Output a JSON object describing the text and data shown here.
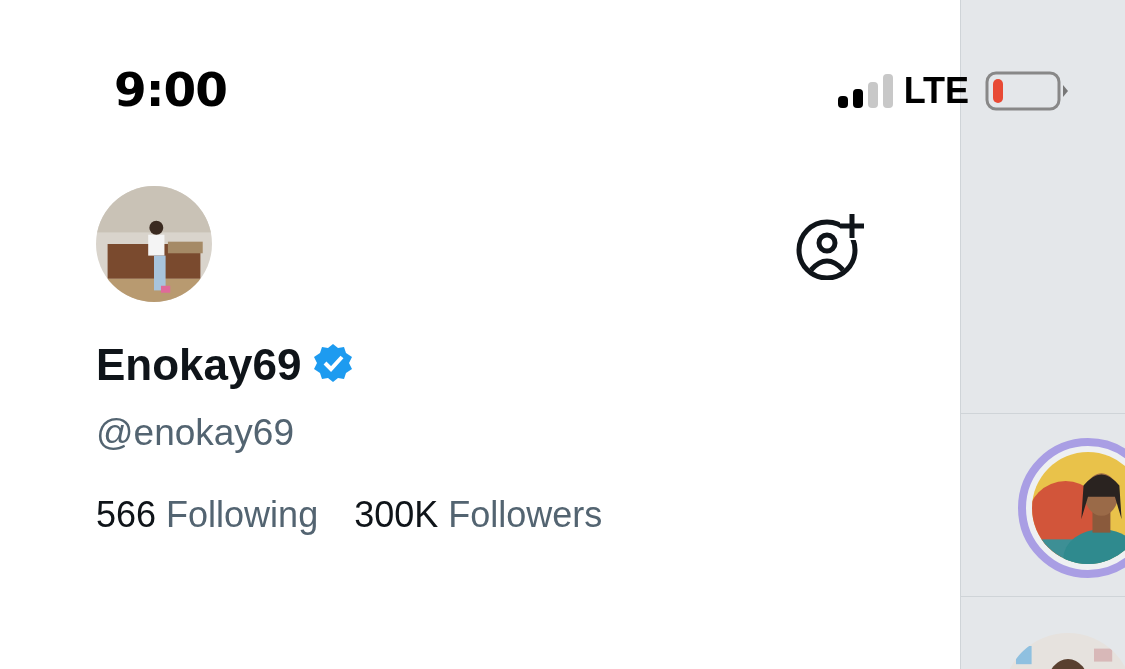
{
  "status_bar": {
    "time": "9:00",
    "network": "LTE"
  },
  "profile": {
    "name": "Enokay69",
    "verified": true,
    "handle": "@enokay69",
    "stats": [
      {
        "count": "566",
        "label": "Following"
      },
      {
        "count": "300K",
        "label": "Followers"
      }
    ]
  },
  "accounts": [
    {
      "kind": "picture",
      "story_ring": true
    },
    {
      "kind": "picture",
      "story_ring": false
    }
  ]
}
